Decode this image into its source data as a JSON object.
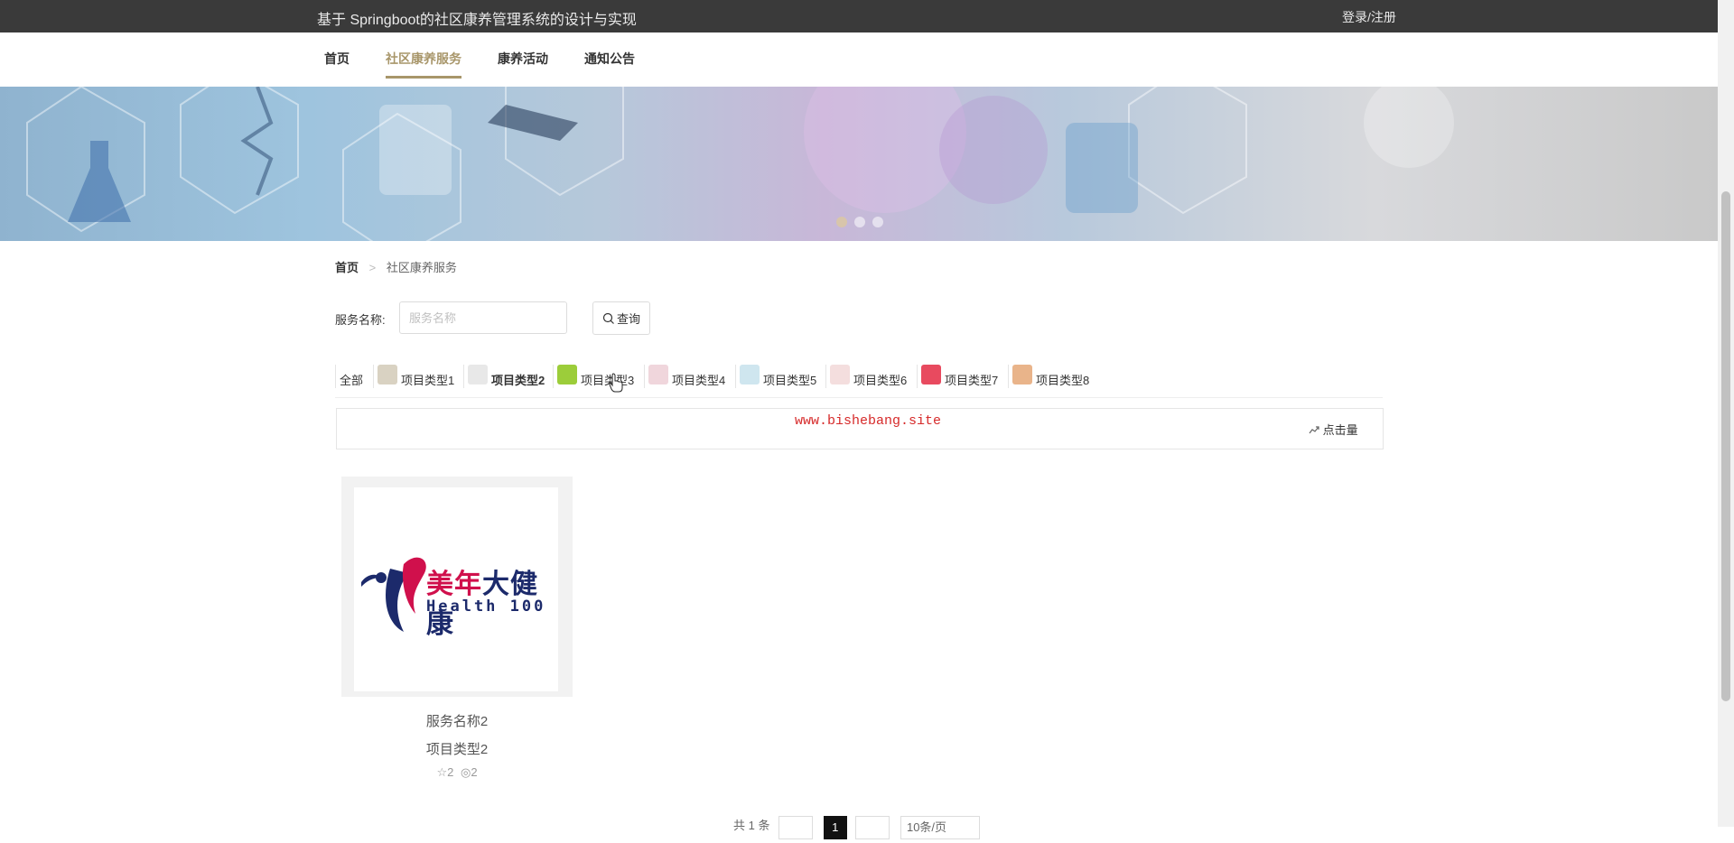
{
  "header": {
    "site_title": "基于 Springboot的社区康养管理系统的设计与实现",
    "login_label": "登录/注册"
  },
  "nav": {
    "items": [
      {
        "label": "首页"
      },
      {
        "label": "社区康养服务",
        "active": true
      },
      {
        "label": "康养活动"
      },
      {
        "label": "通知公告"
      }
    ]
  },
  "banner": {
    "slide_count": 3,
    "active_slide": 0
  },
  "breadcrumb": {
    "home": "首页",
    "separator": ">",
    "current": "社区康养服务"
  },
  "search": {
    "label": "服务名称:",
    "placeholder": "服务名称",
    "value": "",
    "button_label": "查询",
    "button_icon": "search-icon"
  },
  "type_tabs": [
    {
      "label": "全部"
    },
    {
      "label": "项目类型1",
      "icon": "type1-thumbnail"
    },
    {
      "label": "项目类型2",
      "icon": "type2-thumbnail",
      "active": true
    },
    {
      "label": "项目类型3",
      "icon": "type3-thumbnail"
    },
    {
      "label": "项目类型4",
      "icon": "type4-thumbnail"
    },
    {
      "label": "项目类型5",
      "icon": "type5-thumbnail"
    },
    {
      "label": "项目类型6",
      "icon": "type6-thumbnail"
    },
    {
      "label": "项目类型7",
      "icon": "type7-thumbnail"
    },
    {
      "label": "项目类型8",
      "icon": "type8-thumbnail"
    }
  ],
  "sortbar": {
    "watermark": "www.bishebang.site",
    "sort_label": "点击量",
    "sort_icon": "trend-icon"
  },
  "cards": [
    {
      "logo_cn_part1": "美年",
      "logo_cn_part2": "大健康",
      "logo_en": "Health 100",
      "name": "服务名称2",
      "type": "项目类型2",
      "likes": "2",
      "views": "2"
    }
  ],
  "pagination": {
    "total_text": "共 1 条",
    "current_page": "1",
    "page_size_text": "10条/页"
  },
  "colors": {
    "topbar": "#3a3a3a",
    "accent": "#a8966a",
    "watermark": "#d62a2a"
  }
}
